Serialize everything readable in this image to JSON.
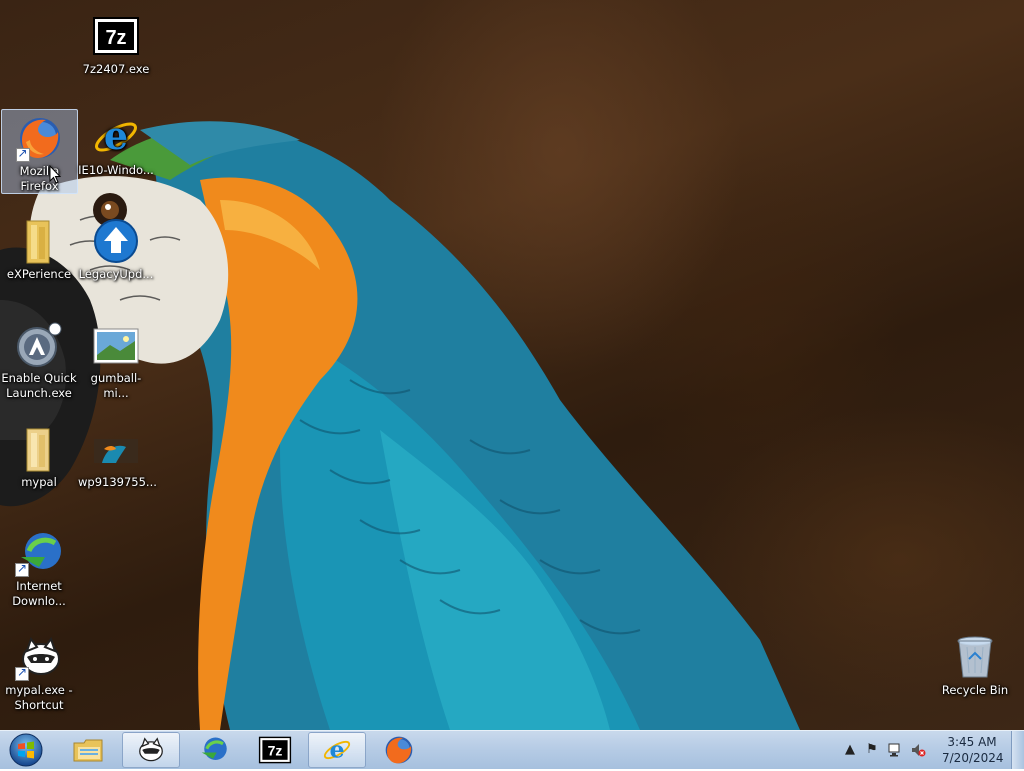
{
  "desktop": {
    "icons": [
      {
        "id": "7z-exe",
        "label": "7z2407.exe"
      },
      {
        "id": "firefox",
        "label": "Mozilla Firefox"
      },
      {
        "id": "ie10",
        "label": "IE10-Windo..."
      },
      {
        "id": "experience",
        "label": "eXPerience"
      },
      {
        "id": "legacyupdate",
        "label": "LegacyUpd..."
      },
      {
        "id": "quicklaunch",
        "label": "Enable Quick Launch.exe"
      },
      {
        "id": "gumball",
        "label": "gumball-mi..."
      },
      {
        "id": "mypal",
        "label": "mypal"
      },
      {
        "id": "wp",
        "label": "wp9139755..."
      },
      {
        "id": "idm",
        "label": "Internet Downlo..."
      },
      {
        "id": "mypal-shortcut",
        "label": "mypal.exe - Shortcut"
      },
      {
        "id": "recycle",
        "label": "Recycle Bin"
      }
    ]
  },
  "taskbar": {
    "pinned": [
      "windows-explorer",
      "mypal",
      "internet-download-manager",
      "7-zip",
      "internet-explorer",
      "firefox"
    ],
    "clock": {
      "time": "3:45 AM",
      "date": "7/20/2024"
    },
    "tray": [
      "show-hidden-icons",
      "action-center-flag",
      "network",
      "volume-muted"
    ]
  },
  "colors": {
    "taskbar": "#b8cde6",
    "selection": "#aac8f0",
    "ie_blue": "#1e88d8",
    "firefox_orange": "#f26b1d"
  }
}
